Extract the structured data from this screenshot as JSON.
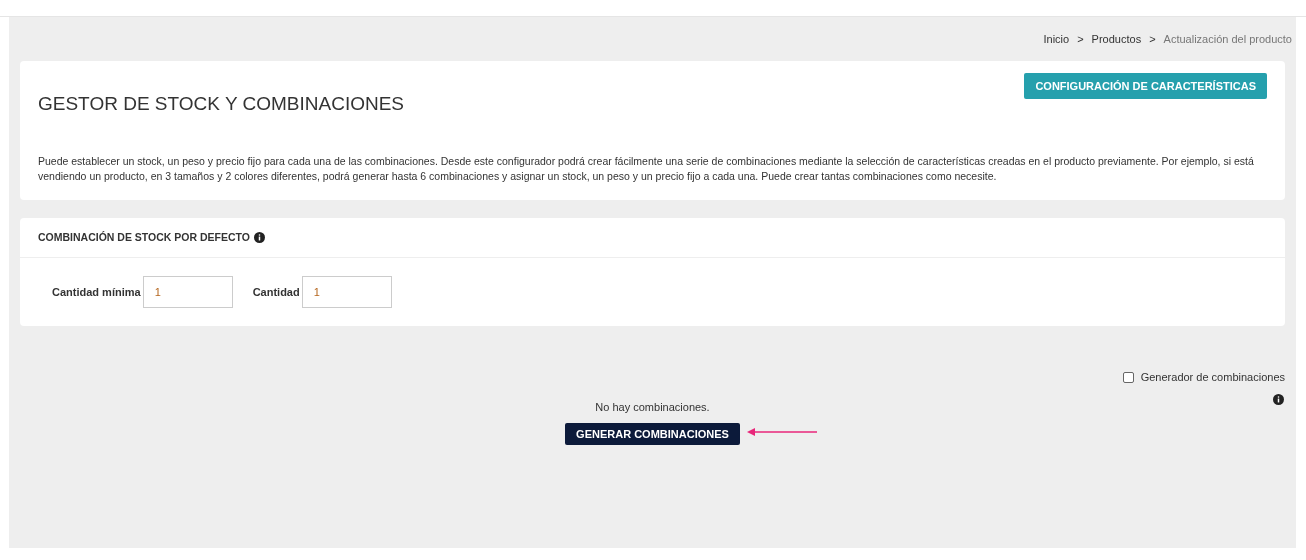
{
  "breadcrumb": {
    "separator": ">",
    "items": [
      "Inicio",
      "Productos",
      "Actualización del producto"
    ]
  },
  "header_card": {
    "title": "GESTOR DE STOCK Y COMBINACIONES",
    "button": "CONFIGURACIÓN DE CARACTERÍSTICAS",
    "description": "Puede establecer un stock, un peso y precio fijo para cada una de las combinaciones. Desde este configurador podrá crear fácilmente una serie de combinaciones mediante la selección de características creadas en el producto previamente. Por ejemplo, si está vendiendo un producto, en 3 tamaños y 2 colores diferentes, podrá generar hasta 6 combinaciones y asignar un stock, un peso y un precio fijo a cada una. Puede crear tantas combinaciones como necesite."
  },
  "default_stock": {
    "title": "COMBINACIÓN DE STOCK POR DEFECTO",
    "fields": [
      {
        "label": "Cantidad mínima",
        "value": "1"
      },
      {
        "label": "Cantidad",
        "value": "1"
      }
    ]
  },
  "generator": {
    "label": "Generador de combinaciones",
    "checked": false
  },
  "empty_message": "No hay combinaciones.",
  "generate_button": "GENERAR COMBINACIONES"
}
